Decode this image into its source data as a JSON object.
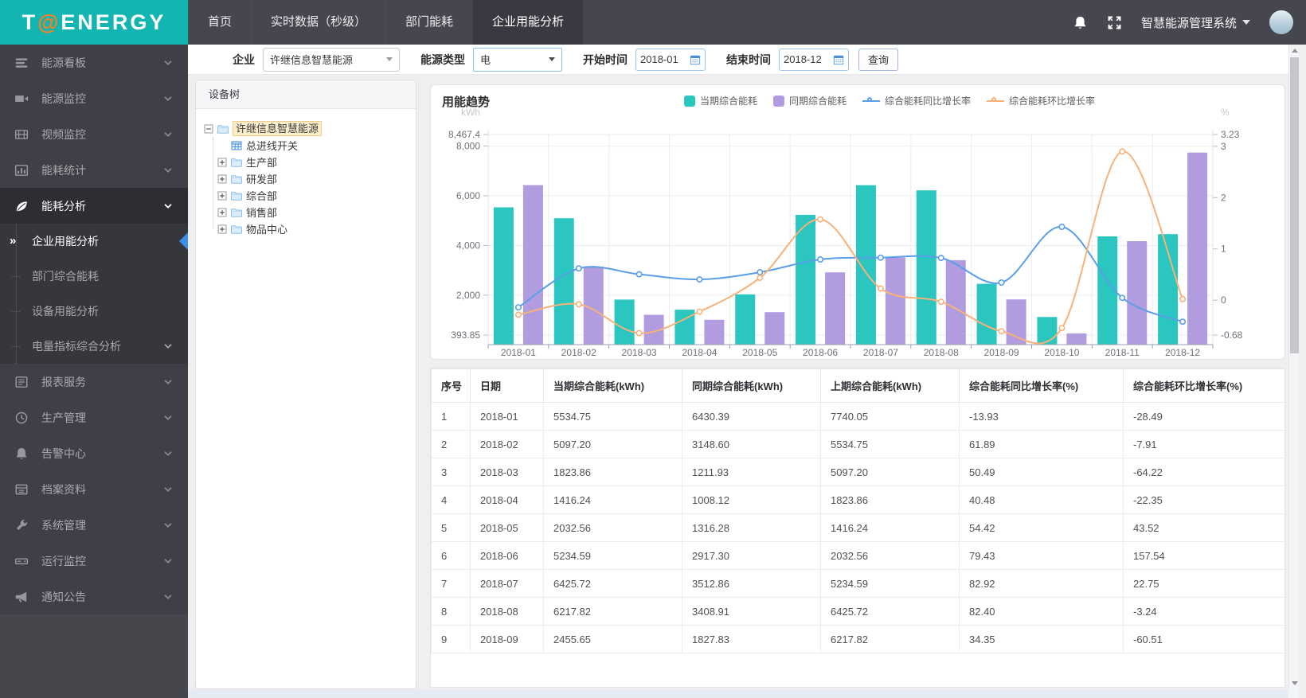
{
  "topbar": {
    "logo": {
      "pre": "T",
      "at": "@",
      "post": "ENERGY"
    },
    "nav": [
      {
        "label": "首页",
        "active": false
      },
      {
        "label": "实时数据（秒级）",
        "active": false
      },
      {
        "label": "部门能耗",
        "active": false
      },
      {
        "label": "企业用能分析",
        "active": true
      }
    ],
    "system_name": "智慧能源管理系统"
  },
  "sidebar": {
    "items": [
      {
        "icon": "dashboard-icon",
        "label": "能源看板"
      },
      {
        "icon": "camera-icon",
        "label": "能源监控"
      },
      {
        "icon": "film-icon",
        "label": "视频监控"
      },
      {
        "icon": "stats-icon",
        "label": "能耗统计"
      },
      {
        "icon": "leaf-icon",
        "label": "能耗分析",
        "active": true,
        "open": true,
        "children": [
          {
            "label": "企业用能分析",
            "active": true
          },
          {
            "label": "部门综合能耗"
          },
          {
            "label": "设备用能分析"
          },
          {
            "label": "电量指标综合分析",
            "has_chevron": true
          }
        ]
      },
      {
        "icon": "report-icon",
        "label": "报表服务"
      },
      {
        "icon": "clock-icon",
        "label": "生产管理"
      },
      {
        "icon": "bell-icon",
        "label": "告警中心"
      },
      {
        "icon": "archive-icon",
        "label": "档案资料"
      },
      {
        "icon": "wrench-icon",
        "label": "系统管理"
      },
      {
        "icon": "drive-icon",
        "label": "运行监控"
      },
      {
        "icon": "megaphone-icon",
        "label": "通知公告"
      }
    ]
  },
  "filter": {
    "company_label": "企业",
    "company_value": "许继信息智慧能源",
    "energy_label": "能源类型",
    "energy_value": "电",
    "start_label": "开始时间",
    "start_value": "2018-01",
    "end_label": "结束时间",
    "end_value": "2018-12",
    "query_label": "查询"
  },
  "tree": {
    "title": "设备树",
    "root": {
      "label": "许继信息智慧能源",
      "selected": true
    },
    "children": [
      {
        "label": "总进线开关",
        "type": "device",
        "expandable": false
      },
      {
        "label": "生产部",
        "type": "folder",
        "expandable": true
      },
      {
        "label": "研发部",
        "type": "folder",
        "expandable": true
      },
      {
        "label": "综合部",
        "type": "folder",
        "expandable": true
      },
      {
        "label": "销售部",
        "type": "folder",
        "expandable": true
      },
      {
        "label": "物品中心",
        "type": "folder",
        "expandable": true
      }
    ]
  },
  "chart_data": {
    "type": "bar",
    "title": "用能趋势",
    "categories": [
      "2018-01",
      "2018-02",
      "2018-03",
      "2018-04",
      "2018-05",
      "2018-06",
      "2018-07",
      "2018-08",
      "2018-09",
      "2018-10",
      "2018-11",
      "2018-12"
    ],
    "series": [
      {
        "name": "当期综合能耗",
        "type": "bar",
        "axis": "left",
        "color": "#2bc6bf",
        "values": [
          5534.75,
          5097.2,
          1823.86,
          1416.24,
          2032.56,
          5234.59,
          6425.72,
          6217.82,
          2455.65,
          1120,
          4367,
          4455
        ]
      },
      {
        "name": "同期综合能耗",
        "type": "bar",
        "axis": "left",
        "color": "#b19ce0",
        "values": [
          6430.39,
          3148.6,
          1211.93,
          1008.12,
          1316.28,
          2917.3,
          3512.86,
          3408.91,
          1827.83,
          460,
          4175,
          7740.05
        ]
      },
      {
        "name": "综合能耗同比增长率",
        "type": "line",
        "axis": "right",
        "color": "#5b9ee8",
        "values": [
          -0.1393,
          0.6189,
          0.5049,
          0.4048,
          0.5442,
          0.7943,
          0.8292,
          0.824,
          0.3435,
          1.43,
          0.046,
          -0.42
        ]
      },
      {
        "name": "综合能耗环比增长率",
        "type": "line",
        "axis": "right",
        "color": "#f7b179",
        "values": [
          -0.2849,
          -0.0791,
          -0.6422,
          -0.2235,
          0.4352,
          1.5754,
          0.2275,
          -0.0324,
          -0.6051,
          -0.544,
          2.9,
          0.02
        ]
      }
    ],
    "y_left": {
      "name": "kWh",
      "min": 393.85,
      "max": 8467.4,
      "ticks": [
        393.85,
        2000,
        4000,
        6000,
        8000,
        8467.4
      ]
    },
    "y_right": {
      "name": "%",
      "min": -0.68,
      "max": 3.23,
      "ticks": [
        -0.68,
        0,
        1,
        2,
        3,
        3.23
      ]
    },
    "legend_position": "top",
    "grid": true
  },
  "table": {
    "headers": [
      "序号",
      "日期",
      "当期综合能耗(kWh)",
      "同期综合能耗(kWh)",
      "上期综合能耗(kWh)",
      "综合能耗同比增长率(%)",
      "综合能耗环比增长率(%)"
    ],
    "rows": [
      [
        "1",
        "2018-01",
        "5534.75",
        "6430.39",
        "7740.05",
        "-13.93",
        "-28.49"
      ],
      [
        "2",
        "2018-02",
        "5097.20",
        "3148.60",
        "5534.75",
        "61.89",
        "-7.91"
      ],
      [
        "3",
        "2018-03",
        "1823.86",
        "1211.93",
        "5097.20",
        "50.49",
        "-64.22"
      ],
      [
        "4",
        "2018-04",
        "1416.24",
        "1008.12",
        "1823.86",
        "40.48",
        "-22.35"
      ],
      [
        "5",
        "2018-05",
        "2032.56",
        "1316.28",
        "1416.24",
        "54.42",
        "43.52"
      ],
      [
        "6",
        "2018-06",
        "5234.59",
        "2917.30",
        "2032.56",
        "79.43",
        "157.54"
      ],
      [
        "7",
        "2018-07",
        "6425.72",
        "3512.86",
        "5234.59",
        "82.92",
        "22.75"
      ],
      [
        "8",
        "2018-08",
        "6217.82",
        "3408.91",
        "6425.72",
        "82.40",
        "-3.24"
      ],
      [
        "9",
        "2018-09",
        "2455.65",
        "1827.83",
        "6217.82",
        "34.35",
        "-60.51"
      ]
    ]
  },
  "colors": {
    "brand_teal": "#12b5af",
    "topbar": "#45464e",
    "sidebar": "#3f4047",
    "active_marker_blue": "#3e8fe8",
    "tree_highlight": "#fdeecb",
    "bar_current": "#2bc6bf",
    "bar_previous": "#b19ce0",
    "line_yoy": "#5b9ee8",
    "line_mom": "#f7b179"
  }
}
